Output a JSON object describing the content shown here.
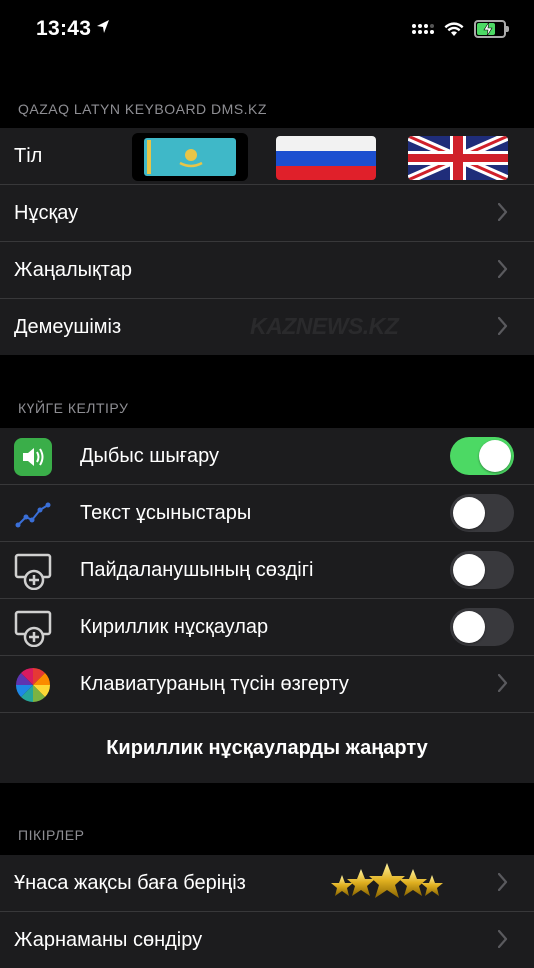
{
  "status": {
    "time": "13:43"
  },
  "section1": {
    "header": "QAZAQ LATYN KEYBOARD DMS.KZ",
    "rows": [
      {
        "label": "Тіл"
      },
      {
        "label": "Нұсқау"
      },
      {
        "label": "Жаңалықтар"
      },
      {
        "label": "Демеушіміз",
        "watermark_kaz": "KAZ",
        "watermark_news": "NEWS.KZ"
      }
    ]
  },
  "section2": {
    "header": "КҮЙГЕ КЕЛТІРУ",
    "rows": [
      {
        "label": "Дыбыс шығару",
        "icon": "speaker-icon",
        "toggle": true
      },
      {
        "label": "Текст ұсыныстары",
        "icon": "chart-line-icon",
        "toggle": false
      },
      {
        "label": "Пайдаланушының сөздігі",
        "icon": "monitor-plus-icon",
        "toggle": false
      },
      {
        "label": "Кириллик нұсқаулар",
        "icon": "monitor-plus-icon",
        "toggle": false
      },
      {
        "label": "Клавиатураның түсін өзгерту",
        "icon": "color-wheel-icon"
      }
    ],
    "button": "Кириллик нұсқауларды жаңарту"
  },
  "section3": {
    "header": "ПІКІРЛЕР",
    "rows": [
      {
        "label": "Ұнаса жақсы баға беріңіз"
      },
      {
        "label": "Жарнаманы сөндіру"
      }
    ]
  },
  "colors": {
    "accent_green": "#4cd964",
    "group_bg": "#1c1c1e",
    "separator": "#38383a"
  }
}
